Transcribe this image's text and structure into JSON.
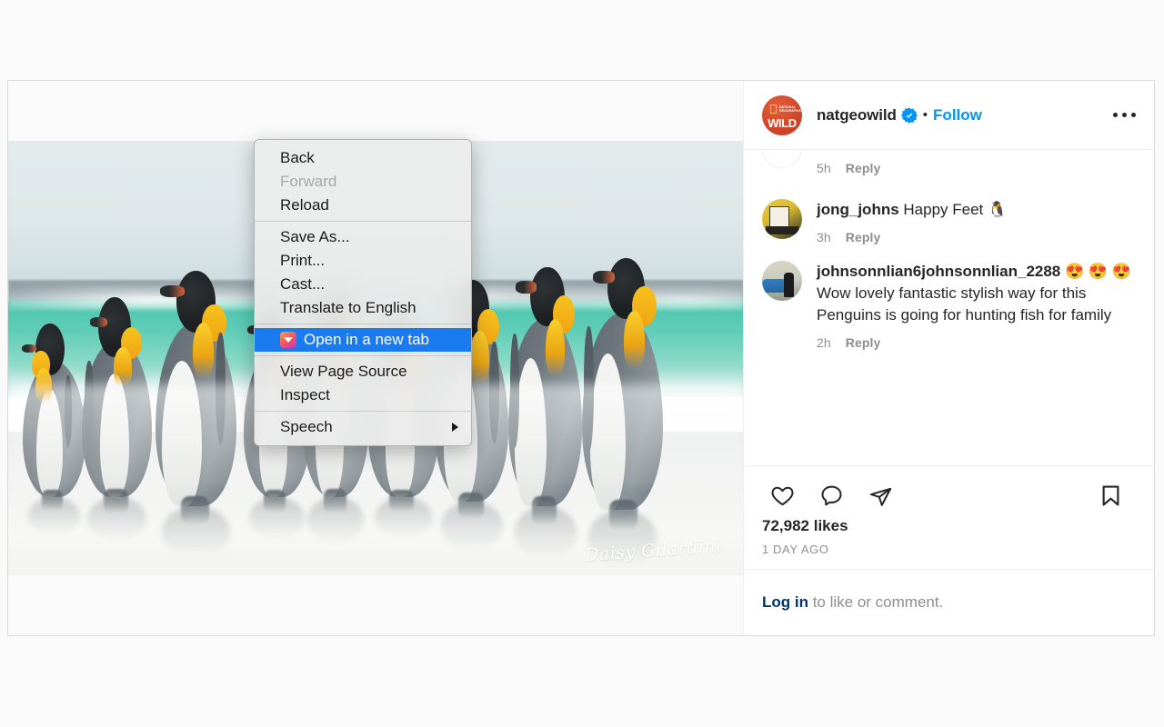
{
  "post": {
    "author": {
      "name": "natgeowild",
      "verified_icon": "verified-badge-icon",
      "avatar_alt": "NATIONAL GEOGRAPHIC WILD",
      "avatar_wordmark": "WILD",
      "avatar_submark": "NATIONAL GEOGRAPHIC"
    },
    "separator_dot": "•",
    "follow_label": "Follow",
    "more_options_icon": "ellipsis-icon",
    "photo": {
      "alt": "King penguins walking along a beach with turquoise surf",
      "watermark": "Daisy Gilardini"
    },
    "likes": "72,982 likes",
    "timestamp": "1 DAY AGO",
    "actions": [
      {
        "icon": "heart-icon",
        "label": "Like"
      },
      {
        "icon": "comment-icon",
        "label": "Comment"
      },
      {
        "icon": "share-icon",
        "label": "Share"
      },
      {
        "icon": "bookmark-icon",
        "label": "Save"
      }
    ],
    "login_prompt": {
      "link": "Log in",
      "rest": " to like or comment."
    }
  },
  "comments": {
    "partial_top": {
      "time": "5h",
      "reply": "Reply"
    },
    "items": [
      {
        "user": "jong_johns",
        "text": " Happy Feet 🐧",
        "time": "3h",
        "reply": "Reply"
      },
      {
        "user": "johnsonnlian6johnsonnlian_2288",
        "text": " 😍 😍 😍 Wow lovely fantastic stylish way for this Penguins is going for hunting fish for family",
        "time": "2h",
        "reply": "Reply"
      }
    ]
  },
  "context_menu": {
    "groups": [
      {
        "items": [
          {
            "label": "Back",
            "state": "enabled"
          },
          {
            "label": "Forward",
            "state": "disabled"
          },
          {
            "label": "Reload",
            "state": "enabled"
          }
        ]
      },
      {
        "items": [
          {
            "label": "Save As...",
            "state": "enabled"
          },
          {
            "label": "Print...",
            "state": "enabled"
          },
          {
            "label": "Cast...",
            "state": "enabled"
          },
          {
            "label": "Translate to English",
            "state": "enabled"
          }
        ]
      },
      {
        "items": [
          {
            "label": "Open in a new tab",
            "state": "selected",
            "icon": "app-gradient-icon"
          }
        ]
      },
      {
        "items": [
          {
            "label": "View Page Source",
            "state": "enabled"
          },
          {
            "label": "Inspect",
            "state": "enabled"
          }
        ]
      },
      {
        "items": [
          {
            "label": "Speech",
            "state": "enabled",
            "submenu": true
          }
        ]
      }
    ]
  },
  "colors": {
    "accent_blue": "#0095f6",
    "link_dark_blue": "#00376b",
    "menu_highlight": "#1a7af0",
    "text_primary": "#262626",
    "text_secondary": "#8e8e8e",
    "border": "#dbdbdb",
    "page_bg": "#fafafa"
  }
}
